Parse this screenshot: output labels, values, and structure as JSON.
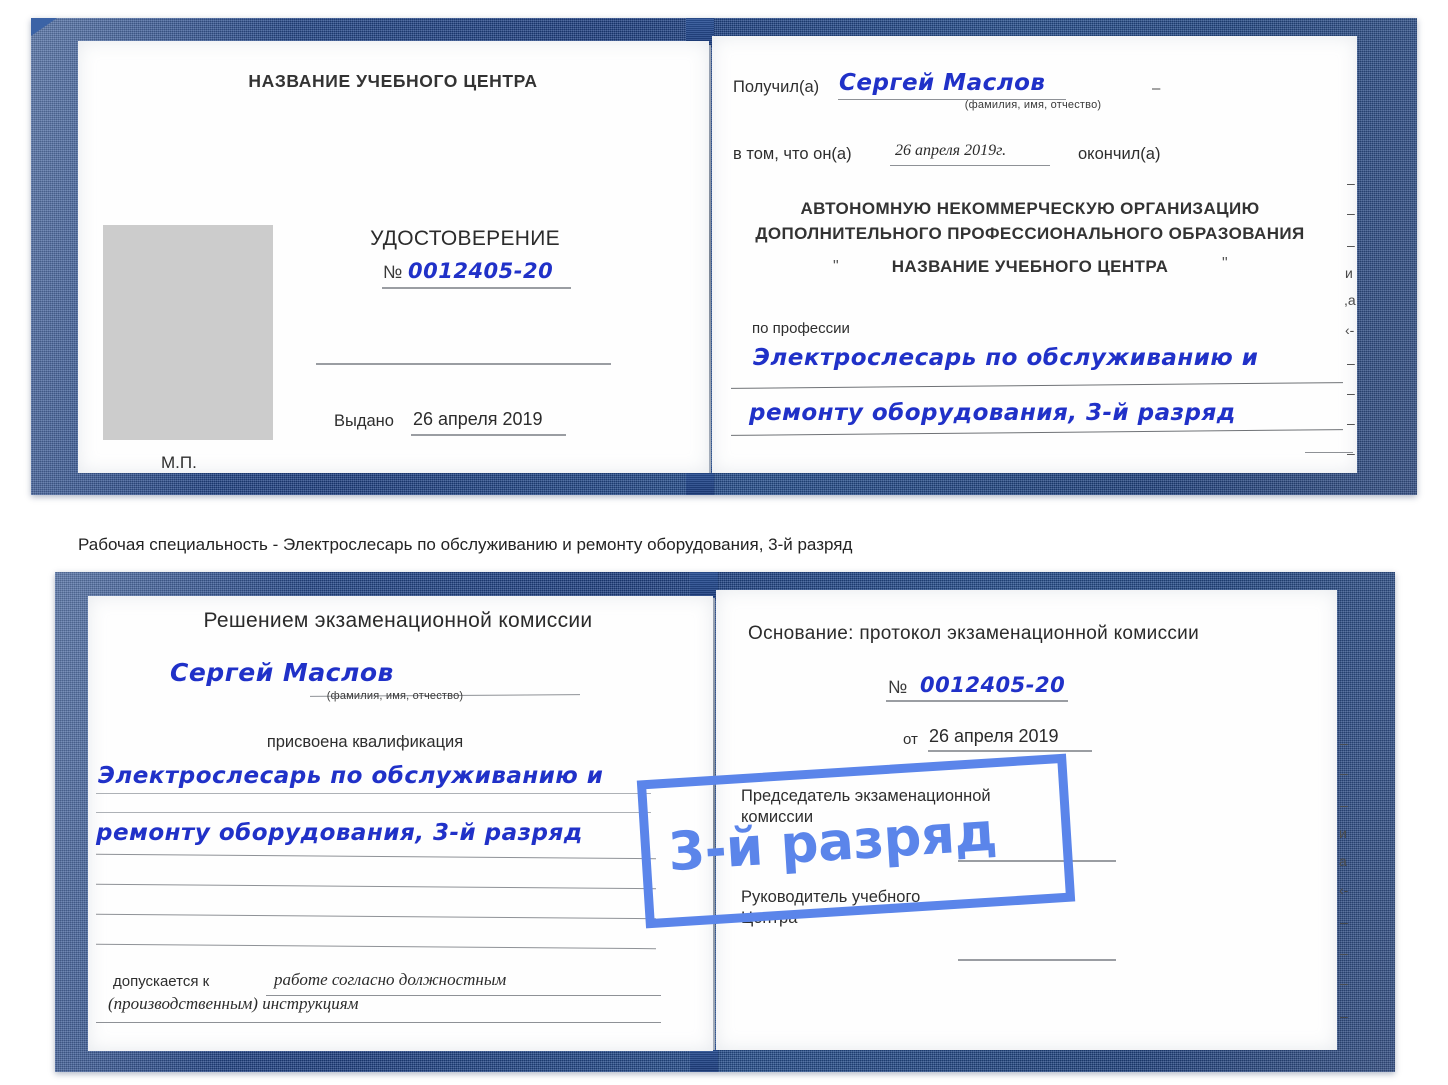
{
  "meta": {
    "accent_blue": "#5b85ea",
    "ink_blue": "#2433cc",
    "cover_blue": "#234a8c",
    "photo_gray": "#cccccc"
  },
  "caption": {
    "text": "Рабочая специальность - Электрослесарь по обслуживанию и ремонту оборудования, 3-й разряд"
  },
  "stamp": {
    "text": "3-й разряд"
  },
  "top_book": {
    "left_page": {
      "center_title": "НАЗВАНИЕ УЧЕБНОГО ЦЕНТРА",
      "doc_word": "УДОСТОВЕРЕНИЕ",
      "number_symbol": "№",
      "number_value": "0012405-20",
      "issued_label": "Выдано",
      "issued_value": "26 апреля 2019",
      "seal_label": "М.П."
    },
    "right_page": {
      "received_label": "Получил(а)",
      "received_value": "Сергей Маслов",
      "fio_hint": "(фамилия, имя, отчество)",
      "that_he_label": "в том, что он(а)",
      "date_value": "26 апреля 2019г.",
      "finished_label": "окончил(а)",
      "org_line1": "АВТОНОМНУЮ НЕКОММЕРЧЕСКУЮ ОРГАНИЗАЦИЮ",
      "org_line2": "ДОПОЛНИТЕЛЬНОГО ПРОФЕССИОНАЛЬНОГО ОБРАЗОВАНИЯ",
      "org_quote_open": "\"",
      "org_line3": "НАЗВАНИЕ УЧЕБНОГО ЦЕНТРА",
      "org_quote_close": "\"",
      "profession_label": "по профессии",
      "profession_line1": "Электрослесарь по обслуживанию и",
      "profession_line2": "ремонту оборудования, 3-й разряд",
      "margin_scraps": [
        "–",
        "–",
        "–",
        "–",
        "и",
        ",а",
        "‹-",
        "–",
        "–",
        "–"
      ]
    }
  },
  "bottom_book": {
    "left_page": {
      "title": "Решением экзаменационной комиссии",
      "name_value": "Сергей Маслов",
      "fio_hint": "(фамилия, имя, отчество)",
      "qualification_label": "присвоена квалификация",
      "qualification_line1": "Электрослесарь по обслуживанию и",
      "qualification_line2": "ремонту оборудования, 3-й разряд",
      "admitted_label": "допускается к",
      "admitted_value_line1": "работе согласно должностным",
      "admitted_value_line2": "(производственным) инструкциям"
    },
    "right_page": {
      "basis_label": "Основание: протокол экзаменационной комиссии",
      "number_symbol": "№",
      "number_value": "0012405-20",
      "from_label": "от",
      "from_value": "26 апреля 2019",
      "chairman_line1": "Председатель экзаменационной",
      "chairman_line2": "комиссии",
      "head_line1": "Руководитель учебного",
      "head_line2": "Центра",
      "margin_scraps": [
        "–",
        "–",
        "–",
        "и",
        "а",
        "‹-",
        "–",
        "–",
        "–",
        "–"
      ]
    }
  }
}
